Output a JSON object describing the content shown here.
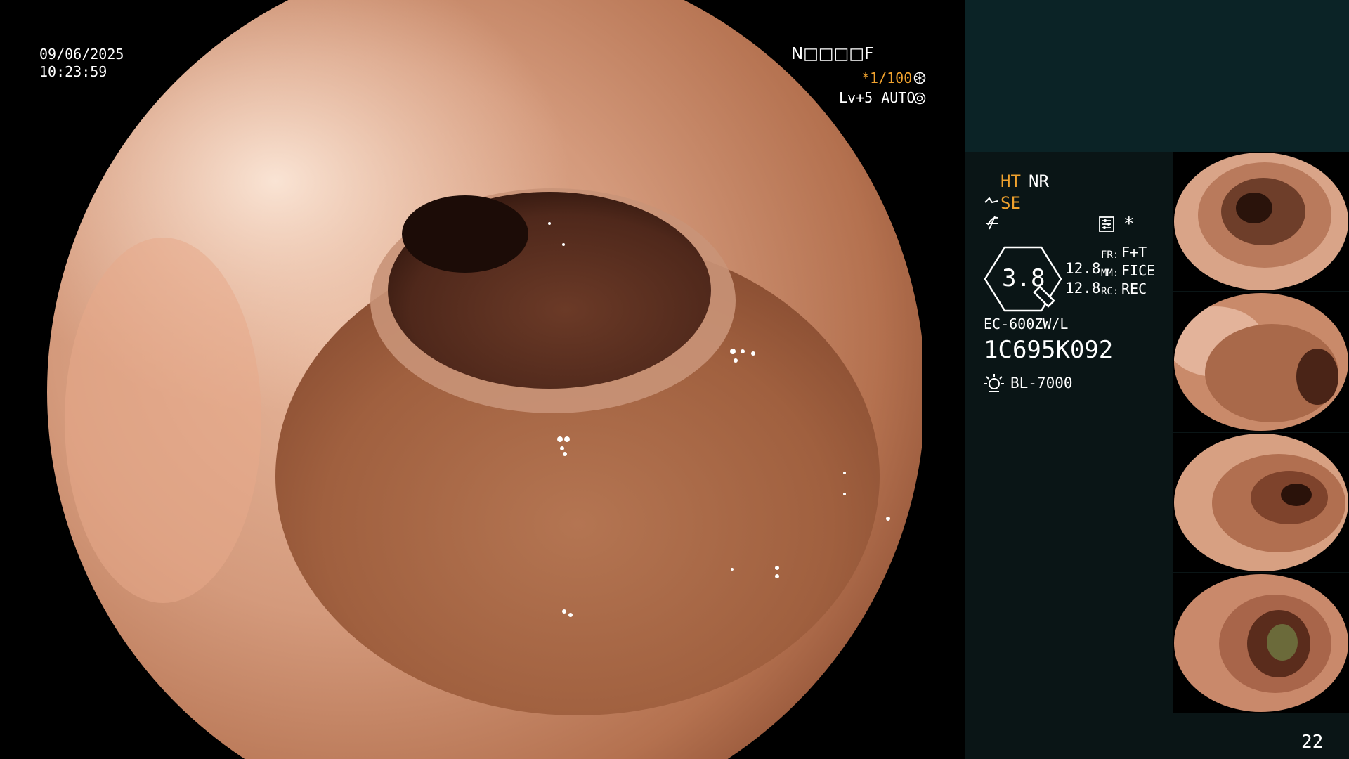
{
  "scope_overlay": {
    "date": "09/06/2025",
    "time": "10:23:59",
    "patient_code": "N□□□□F",
    "shutter": "*1/100",
    "level_mode": "Lv+5 AUTO"
  },
  "sidebar": {
    "ht": "HT",
    "nr": "NR",
    "se": "SE",
    "asterisk": "*",
    "zoom": "3.8",
    "val_top": "12.8",
    "val_bottom": "12.8",
    "fr_label": "FR:",
    "fr_value": "F+T",
    "mm_label": "MM:",
    "mm_value": "FICE",
    "rc_label": "RC:",
    "rc_value": "REC",
    "scope_model": "EC-600ZW/L",
    "serial": "1C695K092",
    "light_source": "BL-7000",
    "frame_count": "22"
  },
  "thumbnails": [
    {
      "label": "captured-image-1"
    },
    {
      "label": "captured-image-2"
    },
    {
      "label": "captured-image-3"
    },
    {
      "label": "captured-image-4"
    }
  ],
  "colors": {
    "overlay_orange": "#f0a22e",
    "panel_bg": "#0a1516",
    "panel_top_bg": "#0b2326"
  }
}
